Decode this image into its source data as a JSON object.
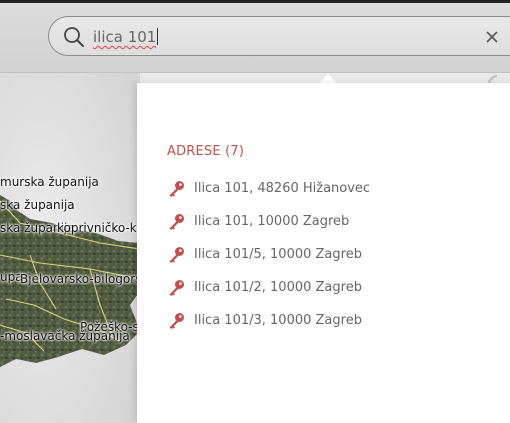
{
  "search": {
    "value": "ilica 101",
    "placeholder": ""
  },
  "map": {
    "labels": [
      "murska županija",
      "ska županija",
      "ska županija",
      "koprivničko-križevačka ž",
      "upa",
      "Bjelovarsko-bilogorsk",
      "Požeško-s",
      "-moslavačka županija"
    ]
  },
  "results": {
    "section_title": "ADRESE (7)",
    "accent_color": "#c0504d",
    "icon": "key-icon",
    "items": [
      "Ilica 101, 48260 Hižanovec",
      "Ilica 101, 10000 Zagreb",
      "Ilica 101/5, 10000 Zagreb",
      "Ilica 101/2, 10000 Zagreb",
      "Ilica 101/3, 10000 Zagreb"
    ]
  }
}
